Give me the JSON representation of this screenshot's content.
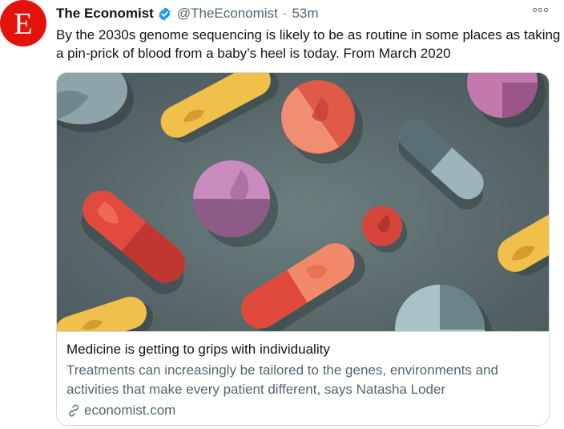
{
  "tweet": {
    "author": {
      "display_name": "The Economist",
      "handle": "@TheEconomist",
      "avatar_letter": "E",
      "verified": true
    },
    "separator": "·",
    "time": "53m",
    "text": "By the 2030s genome sequencing is likely to be as routine in some places as taking a pin-prick of blood from a baby’s heel is today. From March 2020"
  },
  "card": {
    "title": "Medicine is getting to grips with individuality",
    "description": "Treatments can increasingly be tailored to the genes, environments and activities that make every patient different, says Natasha Loder",
    "domain": "economist.com"
  },
  "icons": {
    "verified": "verified-badge-icon",
    "more": "more-options-icon",
    "link": "link-icon"
  },
  "colors": {
    "brand_red": "#e3120b",
    "verified_blue": "#1d9bf0",
    "secondary_text": "#536471",
    "card_border": "#cfd9de",
    "image_background": "#5a6b6d"
  }
}
